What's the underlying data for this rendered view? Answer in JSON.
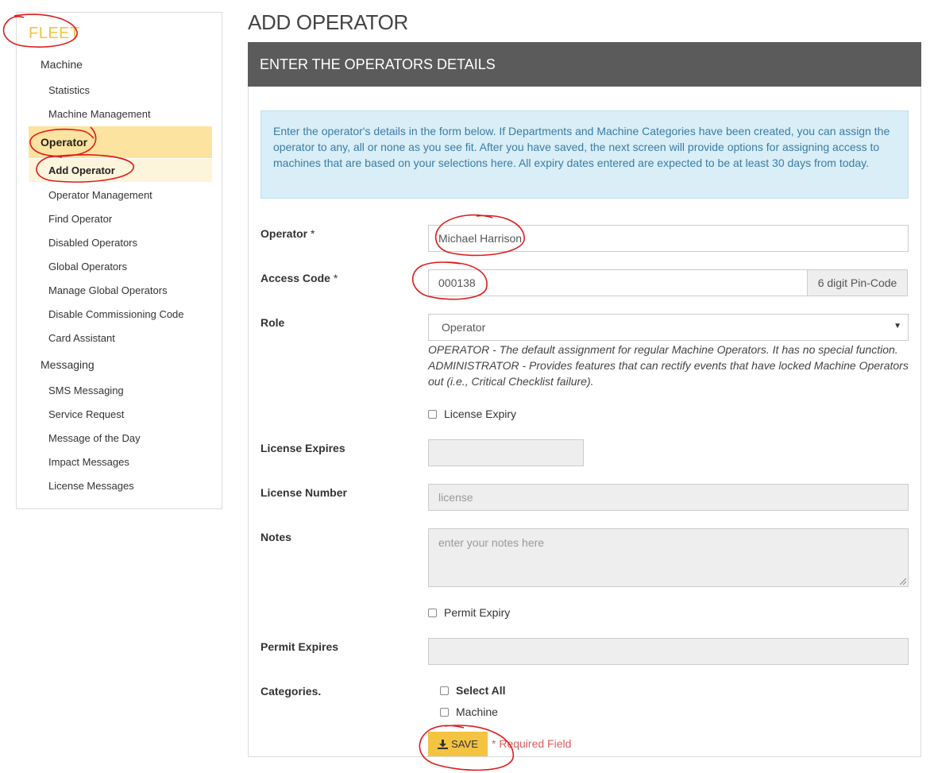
{
  "sidebar": {
    "brand": "FLEET",
    "sections": [
      {
        "label": "Machine",
        "items": [
          "Statistics",
          "Machine Management"
        ]
      },
      {
        "label": "Operator",
        "items": [
          "Add Operator",
          "Operator Management",
          "Find Operator",
          "Disabled Operators",
          "Global Operators",
          "Manage Global Operators",
          "Disable Commissioning Code",
          "Card Assistant"
        ]
      },
      {
        "label": "Messaging",
        "items": [
          "SMS Messaging",
          "Service Request",
          "Message of the Day",
          "Impact Messages",
          "License Messages"
        ]
      }
    ],
    "active_section": "Operator",
    "active_item": "Add Operator"
  },
  "page": {
    "title": "ADD OPERATOR",
    "panel_title": "ENTER THE OPERATORS DETAILS",
    "info": "Enter the operator's details in the form below. If Departments and Machine Categories have been created, you can assign the operator to any, all or none as you see fit. After you have saved, the next screen will provide options for assigning access to machines that are based on your selections here. All expiry dates entered are expected to be at least 30 days from today."
  },
  "form": {
    "operator": {
      "label": "Operator",
      "required": "*",
      "value": "Michael Harrison"
    },
    "access_code": {
      "label": "Access Code",
      "required": "*",
      "value": "000138",
      "addon": "6 digit Pin-Code"
    },
    "role": {
      "label": "Role",
      "value": "Operator",
      "help": "OPERATOR - The default assignment for regular Machine Operators. It has no special function. ADMINISTRATOR - Provides features that can rectify events that have locked Machine Operators out (i.e., Critical Checklist failure)."
    },
    "license_expiry_checkbox": "License Expiry",
    "license_expires": {
      "label": "License Expires",
      "value": ""
    },
    "license_number": {
      "label": "License Number",
      "placeholder": "license"
    },
    "notes": {
      "label": "Notes",
      "placeholder": "enter your notes here"
    },
    "permit_expiry_checkbox": "Permit Expiry",
    "permit_expires": {
      "label": "Permit Expires",
      "value": ""
    },
    "categories": {
      "label": "Categories.",
      "select_all": "Select All",
      "options": [
        "Machine"
      ]
    },
    "save_label": "SAVE",
    "required_note": "* Required Field"
  },
  "colors": {
    "brand": "#f5c342",
    "active_section_bg": "#fce39f",
    "active_item_bg": "#fdf4dc",
    "panel_header_bg": "#5b5b5b",
    "info_bg": "#d9eef7",
    "info_text": "#3a7ca5",
    "save_button": "#f5c342",
    "required_note": "#e05d5d",
    "annotation": "#e01b1b"
  }
}
